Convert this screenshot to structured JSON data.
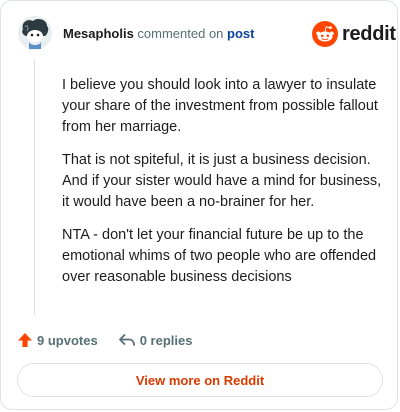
{
  "comment": {
    "author": "Mesapholis",
    "action_text": "commented on",
    "post_link": "post",
    "paragraphs": [
      "I believe you should look into a lawyer to insulate your share of the investment from possible fallout from her marriage.",
      "That is not spiteful, it is just a business decision. And if your sister would have a mind for business, it would have been a no-brainer for her.",
      "NTA - don't let your financial future be up to the emotional whims of two people who are offended over reasonable business decisions"
    ]
  },
  "brand": {
    "wordmark": "reddit",
    "accent_color": "#ff4500"
  },
  "footer": {
    "upvotes": "9 upvotes",
    "replies": "0 replies",
    "upvote_icon": "upvote-arrow-icon",
    "reply_icon": "reply-arrow-icon"
  },
  "cta": {
    "label": "View more on Reddit",
    "color": "#d93a00"
  }
}
